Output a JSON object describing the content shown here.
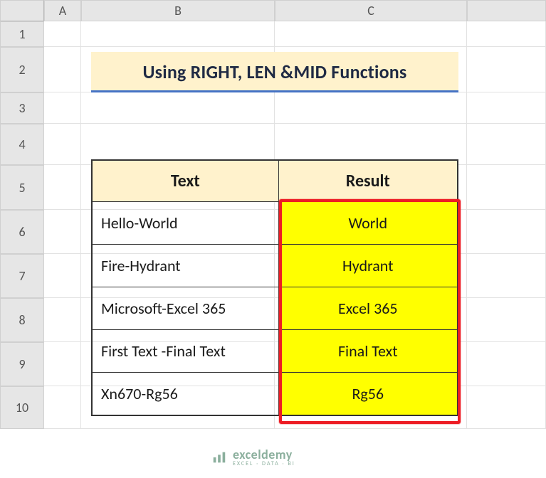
{
  "columns": [
    "A",
    "B",
    "C"
  ],
  "rows": [
    "1",
    "2",
    "3",
    "4",
    "5",
    "6",
    "7",
    "8",
    "9",
    "10"
  ],
  "title": "Using RIGHT, LEN &MID Functions",
  "table": {
    "headers": {
      "text": "Text",
      "result": "Result"
    },
    "data": [
      {
        "text": "Hello-World",
        "result": "World"
      },
      {
        "text": "Fire-Hydrant",
        "result": "Hydrant"
      },
      {
        "text": "Microsoft-Excel 365",
        "result": "Excel 365"
      },
      {
        "text": "First Text -Final Text",
        "result": "Final Text"
      },
      {
        "text": "Xn670-Rg56",
        "result": "Rg56"
      }
    ]
  },
  "watermark": {
    "brand": "exceldemy",
    "tag": "EXCEL · DATA · BI"
  },
  "chart_data": {
    "type": "table",
    "title": "Using RIGHT, LEN &MID Functions",
    "columns": [
      "Text",
      "Result"
    ],
    "rows": [
      [
        "Hello-World",
        "World"
      ],
      [
        "Fire-Hydrant",
        "Hydrant"
      ],
      [
        "Microsoft-Excel 365",
        "Excel 365"
      ],
      [
        "First Text -Final Text",
        "Final Text"
      ],
      [
        "Xn670-Rg56",
        "Rg56"
      ]
    ]
  }
}
